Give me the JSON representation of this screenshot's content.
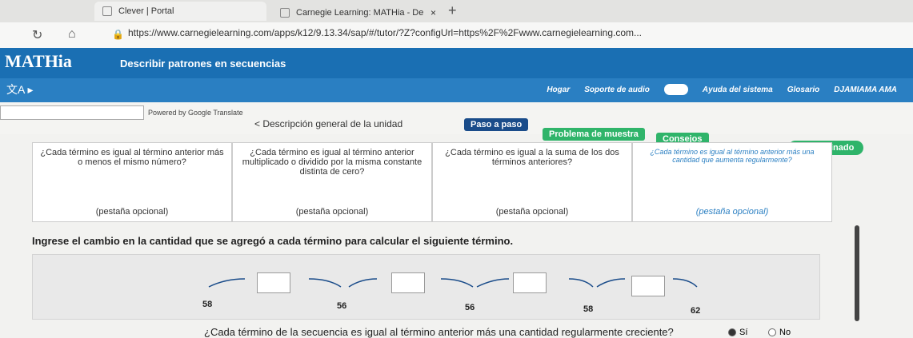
{
  "browser": {
    "tabs": [
      {
        "label": "Clever | Portal"
      },
      {
        "label": "Carnegie Learning: MATHia - De"
      }
    ],
    "url": "https://www.carnegielearning.com/apps/k12/9.13.34/sap/#/tutor/?Z?configUrl=https%2F%2Fwww.carnegielearning.com..."
  },
  "app": {
    "logo": "MATHia",
    "unit_title": "Describir patrones en secuencias",
    "nav": [
      "Hogar",
      "Soporte de audio",
      "Ayuda del sistema",
      "Glosario",
      "DJAMIAMA AMA"
    ],
    "powered": "Powered by Google Translate",
    "overview": "< Descripción general de la unidad",
    "buttons": {
      "step": "Paso a paso",
      "example": "Problema de muestra",
      "hints": "Consejos",
      "done": "He terminado"
    }
  },
  "cards": [
    {
      "text": "¿Cada término es igual al término anterior más o menos el mismo número?",
      "opt": "(pestaña opcional)"
    },
    {
      "text": "¿Cada término es igual al término anterior multiplicado o dividido por la misma constante distinta de cero?",
      "opt": "(pestaña opcional)"
    },
    {
      "text": "¿Cada término es igual a la suma de los dos términos anteriores?",
      "opt": "(pestaña opcional)"
    },
    {
      "text": "¿Cada término es igual al término anterior más una cantidad que aumenta regularmente?",
      "opt": "(pestaña opcional)"
    }
  ],
  "instruction": "Ingrese el cambio en la cantidad que se agregó a cada término para calcular el siguiente término.",
  "sequence": [
    "58",
    "56",
    "56",
    "58",
    "62"
  ],
  "question": "¿Cada término de la secuencia es igual al término anterior más una cantidad regularmente creciente?",
  "answers": {
    "yes": "Sí",
    "no": "No"
  }
}
